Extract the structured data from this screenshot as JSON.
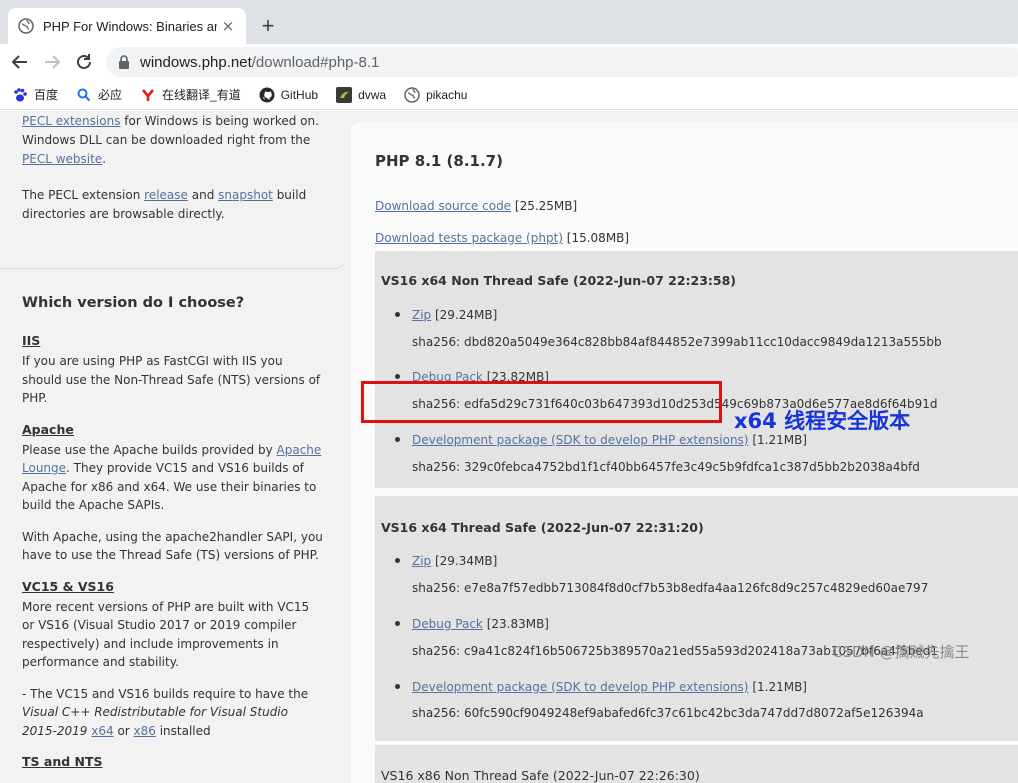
{
  "browser": {
    "tab_title": "PHP For Windows: Binaries and",
    "tab_close": "×",
    "new_tab": "+",
    "url_host": "windows.php.net",
    "url_path": "/download#php-8.1",
    "bookmarks": [
      "百度",
      "必应",
      "在线翻译_有道",
      "GitHub",
      "dvwa",
      "pikachu"
    ]
  },
  "sidebar": {
    "pecl_link": "PECL extensions",
    "pecl_text1": " for Windows is being worked on. Windows DLL can be downloaded right from the ",
    "pecl_website_link": "PECL website",
    "pecl_text2": ".",
    "pecl2_text1": "The PECL extension ",
    "release_link": "release",
    "pecl2_and": " and ",
    "snapshot_link": "snapshot",
    "pecl2_text2": " build directories are browsable directly.",
    "heading": "Which version do I choose?",
    "iis_title": "IIS",
    "iis_text": "If you are using PHP as FastCGI with IIS you should use the Non-Thread Safe (NTS) versions of PHP.",
    "apache_title": "Apache",
    "apache_text1": "Please use the Apache builds provided by ",
    "apache_lounge_link": "Apache Lounge",
    "apache_text2": ". They provide VC15 and VS16 builds of Apache for x86 and x64. We use their binaries to build the Apache SAPIs.",
    "apache_text3": "With Apache, using the apache2handler SAPI, you have to use the Thread Safe (TS) versions of PHP.",
    "vc_title": "VC15 & VS16",
    "vc_text": "More recent versions of PHP are built with VC15 or VS16 (Visual Studio 2017 or 2019 compiler respectively) and include improvements in performance and stability.",
    "vc_text2a": "- The VC15 and VS16 builds require to have the ",
    "vc_text2_italic": "Visual C++ Redistributable for Visual Studio 2015-2019",
    "x64_link": "x64",
    "or": " or ",
    "x86_link": "x86",
    "installed": " installed",
    "ts_title": "TS and NTS"
  },
  "main": {
    "title": "PHP 8.1 (8.1.7)",
    "source_link": "Download source code",
    "source_size": " [25.25MB]",
    "tests_link": "Download tests package (phpt)",
    "tests_size": " [15.08MB]",
    "builds": [
      {
        "heading": "VS16 x64 Non Thread Safe (2022-Jun-07 22:23:58)",
        "items": [
          {
            "link": "Zip",
            "size": " [29.24MB]",
            "sha": "sha256: dbd820a5049e364c828bb84af844852e7399ab11cc10dacc9849da1213a555bb"
          },
          {
            "link": "Debug Pack",
            "size": " [23.82MB]",
            "sha": "sha256: edfa5d29c731f640c03b647393d10d253d549c69b873a0d6e577ae8d6f64b91d"
          },
          {
            "link": "Development package (SDK to develop PHP extensions)",
            "size": " [1.21MB]",
            "sha": "sha256: 329c0febca4752bd1f1cf40bb6457fe3c49c5b9fdfca1c387d5bb2b2038a4bfd"
          }
        ]
      },
      {
        "heading": "VS16 x64 Thread Safe (2022-Jun-07 22:31:20)",
        "items": [
          {
            "link": "Zip",
            "size": " [29.34MB]",
            "sha": "sha256: e7e8a7f57edbb713084f8d0cf7b53b8edfa4aa126fc8d9c257c4829ed60ae797"
          },
          {
            "link": "Debug Pack",
            "size": " [23.83MB]",
            "sha": "sha256: c9a41c824f16b506725b389570a21ed55a593d202418a73ab1057bf6a4f5bed1"
          },
          {
            "link": "Development package (SDK to develop PHP extensions)",
            "size": " [1.21MB]",
            "sha": "sha256: 60fc590cf9049248ef9abafed6fc37c61bc42bc3da747dd7d8072af5e126394a"
          }
        ]
      },
      {
        "heading": "VS16 x86 Non Thread Safe (2022-Jun-07 22:26:30)",
        "items": []
      }
    ]
  },
  "annotation": "x64 线程安全版本",
  "watermark": "CSDN @擒贼先擒王"
}
